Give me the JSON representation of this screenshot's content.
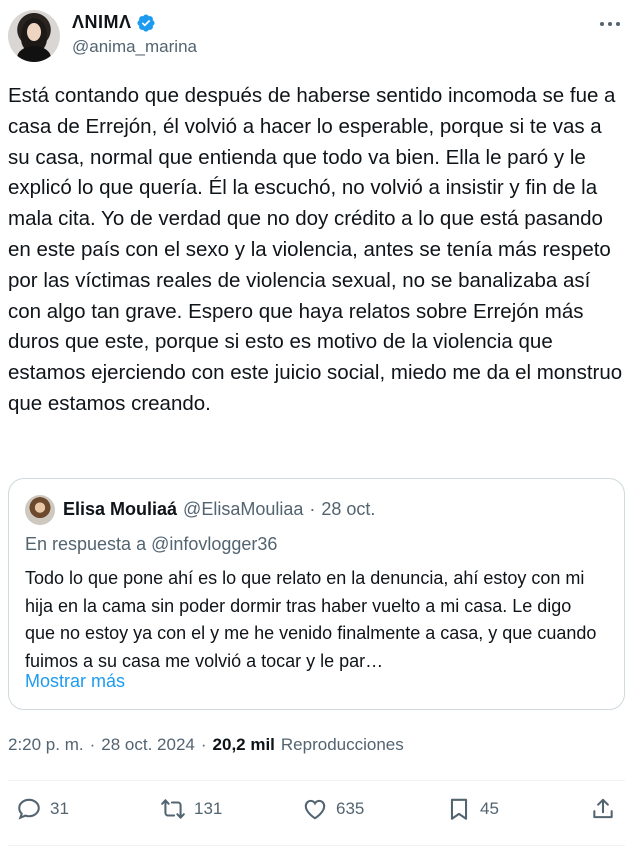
{
  "author": {
    "display_name": "ΛNIMΛ",
    "handle": "@anima_marina",
    "verified": true
  },
  "tweet": {
    "text": "Está contando que después de haberse sentido incomoda se fue a casa de Errejón, él volvió a hacer lo esperable, porque si te vas a su casa, normal que entienda que todo va bien. Ella le paró y le explicó lo que quería. Él la escuchó, no volvió a insistir y fin de la mala cita. Yo de verdad que no doy crédito a lo que está pasando en este país con el sexo y la violencia, antes se tenía más respeto por las víctimas reales de violencia sexual, no se banalizaba así con algo tan grave. Espero que haya relatos sobre Errejón más duros que este, porque si esto es motivo de la violencia que estamos ejerciendo con este juicio social, miedo me da el monstruo que estamos creando."
  },
  "quote": {
    "display_name": "Elisa Mouliaá",
    "handle": "@ElisaMouliaa",
    "separator": "·",
    "date": "28 oct.",
    "reply_to": "En respuesta a @infovlogger36",
    "text": "Todo lo que pone ahí es lo que relato en la denuncia, ahí estoy con mi hija en la cama sin poder dormir tras haber vuelto a mi casa. Le digo que no estoy ya con el y me he venido finalmente a casa, y que cuando fuimos a su casa me volvió a tocar y le par…",
    "show_more": "Mostrar más"
  },
  "meta": {
    "time": "2:20 p. m.",
    "sep1": "·",
    "date": "28 oct. 2024",
    "sep2": "·",
    "views_count": "20,2 mil",
    "views_label": "Reproducciones"
  },
  "actions": {
    "replies": "31",
    "reposts": "131",
    "likes": "635",
    "bookmarks": "45"
  },
  "icons": {
    "verified": "verified-badge-icon",
    "more": "more-icon",
    "reply": "reply-icon",
    "repost": "repost-icon",
    "like": "heart-icon",
    "bookmark": "bookmark-icon",
    "share": "share-icon"
  },
  "colors": {
    "accent": "#1d9bf0",
    "secondary_text": "#536471",
    "border": "#cfd9de"
  }
}
